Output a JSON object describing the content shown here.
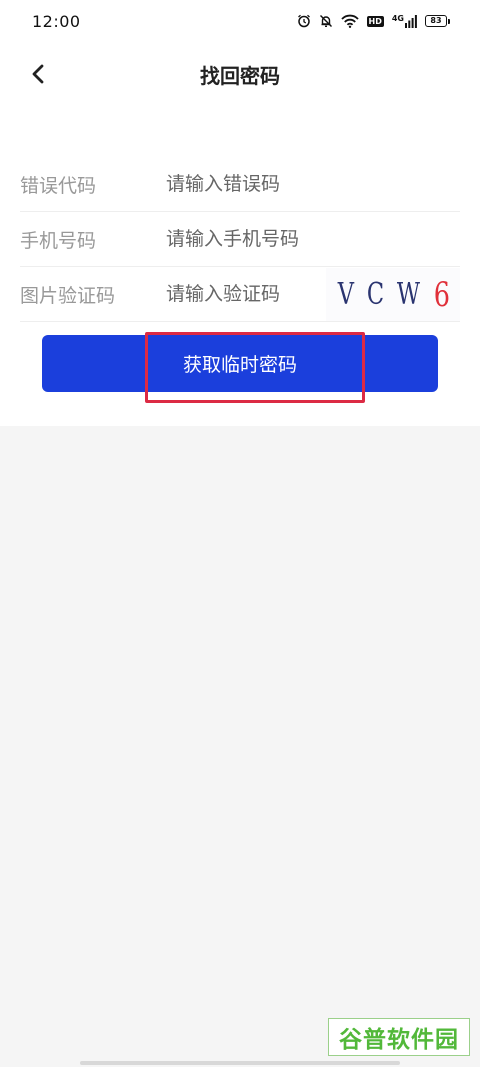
{
  "status_bar": {
    "time": "12:00",
    "network_label": "4G",
    "hd_label": "HD",
    "battery_level": "83",
    "icons": [
      "alarm-icon",
      "mute-bell-icon",
      "wifi-icon",
      "hd-icon",
      "signal-icon",
      "battery-icon"
    ]
  },
  "nav": {
    "title": "找回密码",
    "back_icon": "chevron-left-icon"
  },
  "form": {
    "error_code": {
      "label": "错误代码",
      "placeholder": "请输入错误码",
      "value": ""
    },
    "phone": {
      "label": "手机号码",
      "placeholder": "请输入手机号码",
      "value": ""
    },
    "captcha": {
      "label": "图片验证码",
      "placeholder": "请输入验证码",
      "value": "",
      "image_chars": [
        "V",
        "C",
        "W",
        "6"
      ]
    }
  },
  "actions": {
    "get_temp_password_label": "获取临时密码"
  },
  "colors": {
    "primary": "#1b3fdc",
    "highlight": "#dc2a44",
    "label": "#999999",
    "background": "#f5f5f5"
  },
  "watermark": {
    "text": "谷普软件园"
  }
}
